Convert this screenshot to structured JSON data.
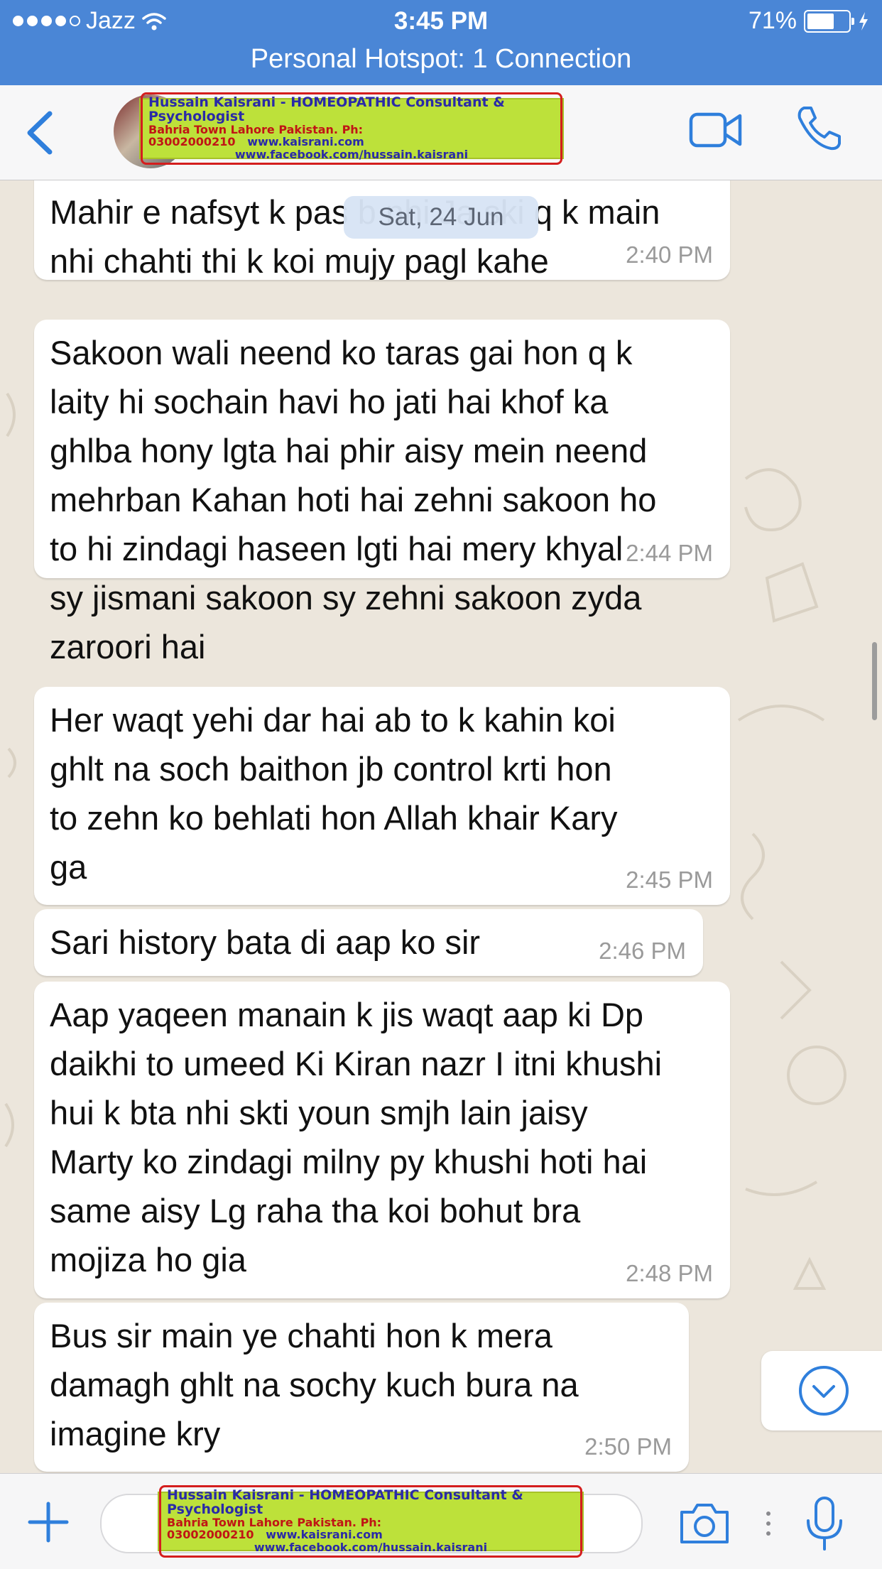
{
  "status_bar": {
    "carrier": "Jazz",
    "time": "3:45 PM",
    "battery": "71%",
    "battery_level": 0.71,
    "hotspot": "Personal Hotspot: 1 Connection"
  },
  "header": {
    "banner": {
      "line1": "Hussain Kaisrani - HOMEOPATHIC Consultant & Psychologist",
      "line2": "Bahria Town Lahore Pakistan. Ph: 03002000210",
      "line2_web": "www.kaisrani.com",
      "line3": "www.facebook.com/hussain.kaisrani"
    }
  },
  "chat": {
    "date_label": "Sat, 24 Jun",
    "messages": [
      {
        "text": "Mahir e nafsyt k pas b nhi Ja ski q k main\nnhi chahti thi k koi mujy pagl kahe",
        "time": "2:40 PM"
      },
      {
        "text": "Sakoon wali neend ko taras gai hon q k\nlaity hi sochain havi ho jati hai khof ka\nghlba hony lgta hai phir aisy mein neend\nmehrban Kahan hoti hai zehni sakoon ho\nto hi zindagi haseen lgti hai mery khyal\nsy jismani sakoon sy zehni sakoon zyda\nzaroori hai",
        "time": "2:44 PM"
      },
      {
        "text": "Her waqt yehi dar hai ab to k kahin koi\nghlt na soch baithon jb control krti hon\nto zehn ko behlati hon Allah khair Kary\nga",
        "time": "2:45 PM"
      },
      {
        "text": "Sari history bata di aap ko sir",
        "time": "2:46 PM"
      },
      {
        "text": "Aap yaqeen manain k jis waqt aap ki Dp\ndaikhi to umeed Ki Kiran nazr I itni khushi\nhui k bta nhi skti youn smjh lain jaisy\nMarty ko zindagi milny py khushi hoti hai\nsame aisy Lg raha tha koi bohut bra\nmojiza ho gia",
        "time": "2:48 PM"
      },
      {
        "text": "Bus sir main ye chahti hon k mera\ndamagh ghlt na sochy kuch bura na\nimagine kry",
        "time": "2:50 PM"
      }
    ]
  },
  "input_bar": {
    "banner": {
      "line1": "Hussain Kaisrani - HOMEOPATHIC Consultant & Psychologist",
      "line2": "Bahria Town Lahore Pakistan. Ph: 03002000210",
      "line2_web": "www.kaisrani.com",
      "line3": "www.facebook.com/hussain.kaisrani"
    }
  },
  "colors": {
    "status_bar": "#4a86d6",
    "accent": "#2f7fdc",
    "bubble": "#ffffff",
    "wallpaper": "#ece6dc",
    "banner_bg": "#bde13a",
    "banner_border": "#d41e1e"
  },
  "icons": {
    "back": "chevron-left-icon",
    "video": "video-camera-icon",
    "call": "phone-icon",
    "plus": "plus-icon",
    "camera": "camera-icon",
    "more": "more-vertical-icon",
    "mic": "microphone-icon",
    "scroll_down": "chevron-down-circle-icon",
    "wifi": "wifi-icon",
    "charging": "lightning-icon"
  }
}
